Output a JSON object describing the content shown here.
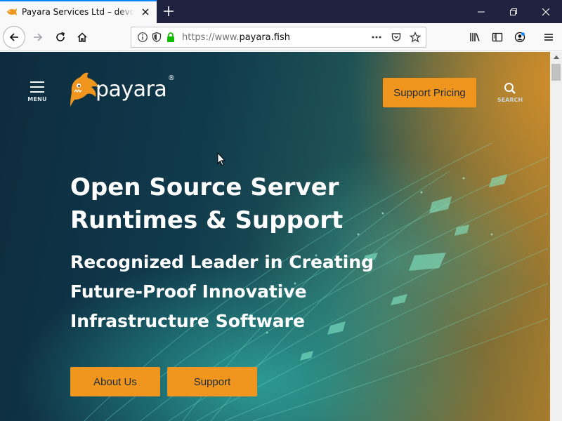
{
  "browser": {
    "tab_title": "Payara Services Ltd – devoted to",
    "url_scheme": "https://www.",
    "url_host": "payara.fish",
    "new_tab_icon": "plus-icon",
    "window_controls": [
      "minimize-icon",
      "restore-icon",
      "close-icon"
    ]
  },
  "page": {
    "menu_label": "MENU",
    "brand_name": "payara",
    "brand_reg": "®",
    "support_pricing_label": "Support Pricing",
    "search_label": "SEARCH",
    "headline": "Open Source Server Runtimes & Support",
    "subheadline": "Recognized Leader in Creating Future-Proof Innovative Infrastructure Software",
    "cta_primary": "About Us",
    "cta_secondary": "Support"
  },
  "colors": {
    "accent_orange": "#f0961e",
    "tab_highlight": "#0a84ff",
    "tabstrip_bg": "#202340",
    "lock_green": "#12bc00"
  }
}
